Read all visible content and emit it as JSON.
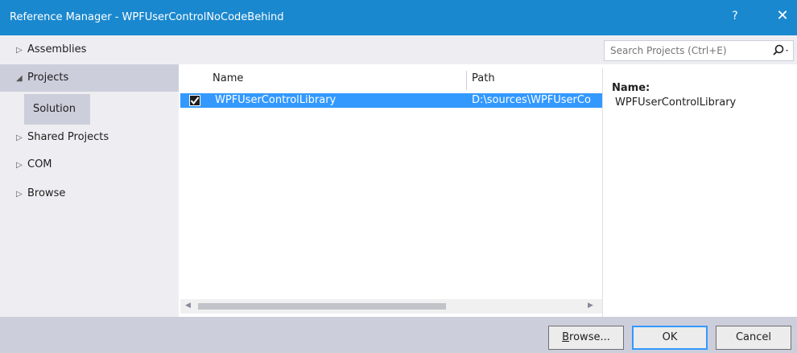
{
  "window": {
    "title": "Reference Manager - WPFUserControlNoCodeBehind",
    "help_label": "?",
    "close_label": "✕"
  },
  "sidebar": {
    "items": [
      {
        "label": "Assemblies",
        "expanded": false
      },
      {
        "label": "Projects",
        "expanded": true
      },
      {
        "label": "Shared Projects",
        "expanded": false
      },
      {
        "label": "COM",
        "expanded": false
      },
      {
        "label": "Browse",
        "expanded": false
      }
    ],
    "sub_item": "Solution"
  },
  "search": {
    "placeholder": "Search Projects (Ctrl+E)",
    "icon": "search-icon"
  },
  "list": {
    "columns": [
      "Name",
      "Path"
    ],
    "rows": [
      {
        "checked": true,
        "name": "WPFUserControlLibrary",
        "path": "D:\\sources\\WPFUserCo"
      }
    ]
  },
  "details": {
    "label": "Name:",
    "value": "WPFUserControlLibrary"
  },
  "footer": {
    "browse_hotkey": "B",
    "browse_rest": "rowse...",
    "ok_label": "OK",
    "cancel_label": "Cancel"
  },
  "colors": {
    "titlebar": "#1a88cf",
    "selection": "#3399ff",
    "sidebar_bg": "#eeeef2",
    "selected_nav": "#cccedb"
  }
}
